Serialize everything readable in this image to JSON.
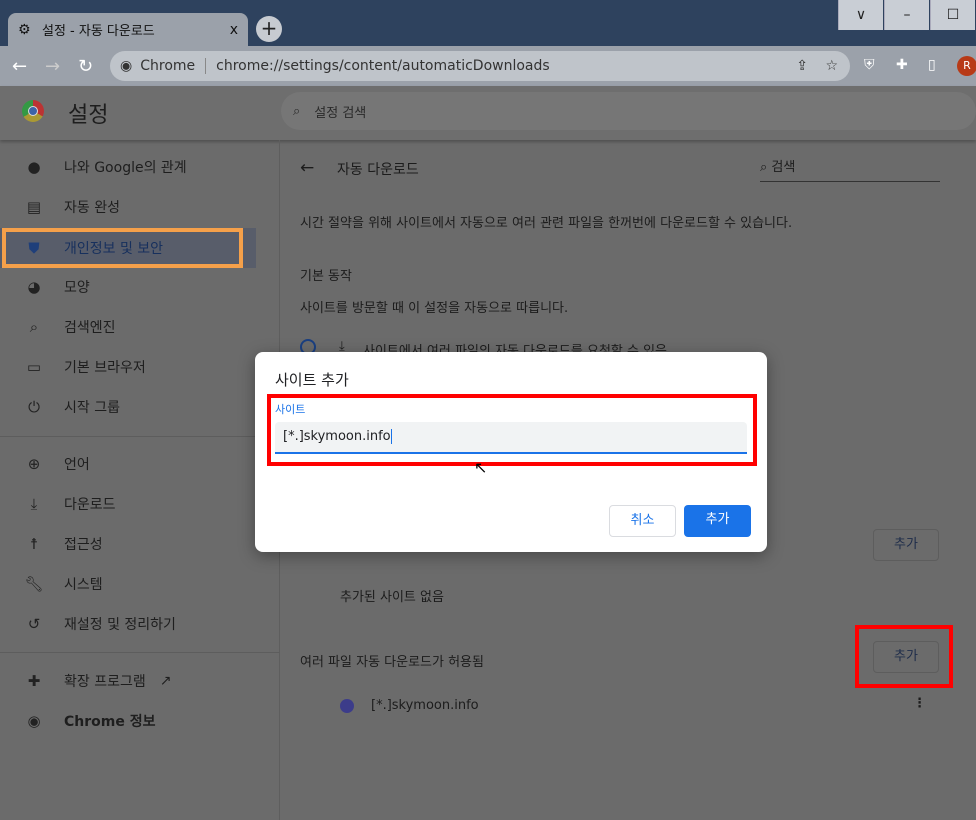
{
  "browser": {
    "tab_title": "설정 - 자동 다운로드",
    "tab_close": "x",
    "new_tab": "+",
    "window_controls": [
      "∨",
      "–",
      "☐"
    ],
    "site_label": "Chrome",
    "url": "chrome://settings/content/automaticDownloads",
    "profile_initial": "R"
  },
  "header": {
    "title": "설정",
    "search_placeholder": "설정 검색"
  },
  "sidebar": {
    "items": [
      {
        "label": "나와 Google의 관계",
        "icon": "person-icon"
      },
      {
        "label": "자동 완성",
        "icon": "clipboard-icon"
      },
      {
        "label": "개인정보 및 보안",
        "icon": "shield-icon",
        "active": true
      },
      {
        "label": "모양",
        "icon": "palette-icon"
      },
      {
        "label": "검색엔진",
        "icon": "search-icon"
      },
      {
        "label": "기본 브라우저",
        "icon": "browser-icon"
      },
      {
        "label": "시작 그룹",
        "icon": "power-icon"
      },
      {
        "label": "언어",
        "icon": "globe-icon"
      },
      {
        "label": "다운로드",
        "icon": "download-icon"
      },
      {
        "label": "접근성",
        "icon": "accessibility-icon"
      },
      {
        "label": "시스템",
        "icon": "wrench-icon"
      },
      {
        "label": "재설정 및 정리하기",
        "icon": "history-icon"
      },
      {
        "label": "확장 프로그램",
        "icon": "extension-icon"
      },
      {
        "label": "Chrome 정보",
        "icon": "chrome-icon"
      }
    ]
  },
  "main": {
    "page_title": "자동 다운로드",
    "search_placeholder": "검색",
    "description": "시간 절약을 위해 사이트에서 자동으로 여러 관련 파일을 한꺼번에 다운로드할 수 있습니다.",
    "default_heading": "기본 동작",
    "default_sub": "사이트를 방문할 때 이 설정을 자동으로 따릅니다.",
    "radio_allow": "사이트에서 여러 파일의 자동 다운로드를 요청할 수 있음",
    "add_label": "추가",
    "no_sites": "추가된 사이트 없음",
    "allowed_heading": "여러 파일 자동 다운로드가 허용됨",
    "allowed_sites": [
      "[*.]skymoon.info"
    ]
  },
  "dialog": {
    "title": "사이트 추가",
    "field_label": "사이트",
    "field_value": "[*.]skymoon.info",
    "cancel": "취소",
    "add": "추가"
  },
  "colors": {
    "accent": "#1a73e8",
    "highlight_red": "#ff0000",
    "highlight_orange": "#f5a04a"
  }
}
